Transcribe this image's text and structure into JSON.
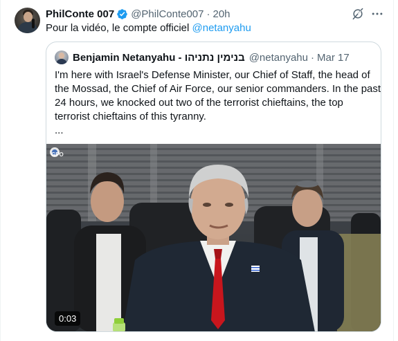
{
  "author": {
    "name": "PhilConte 007",
    "handle": "@PhilConte007",
    "time": "20h",
    "verified": true
  },
  "tweet": {
    "text": "Pour la vidéo, le compte officiel ",
    "mention": "@netanyahu"
  },
  "quoted": {
    "name": "Benjamin Netanyahu - בנימין נתניהו",
    "handle": "@netanyahu",
    "separator": "·",
    "date": "Mar 17",
    "lines": [
      "I'm here with Israel's Defense Minister, our Chief of Staff, the head of",
      "the Mossad, the Chief of Air Force, our senior commanders. In the past",
      "24 hours, we knocked out two of the terrorist chieftains, the top",
      "terrorist chieftains of this tyranny.",
      "..."
    ],
    "video": {
      "watermark": "GPO",
      "duration": "0:03"
    }
  },
  "icons": {
    "badge": "verified-badge-icon",
    "grok": "grok-icon",
    "more": "more-options-icon"
  },
  "colors": {
    "accent": "#1d9bf0",
    "secondary_text": "#536471",
    "border": "#cfd9de"
  }
}
